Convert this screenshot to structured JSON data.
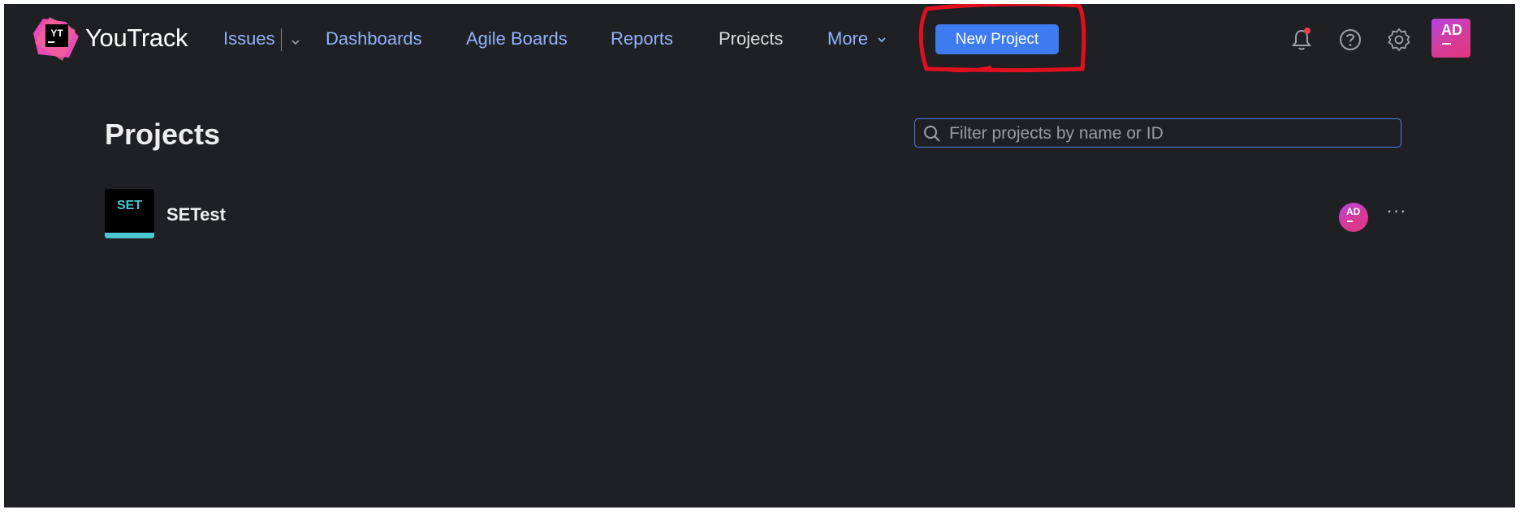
{
  "app": {
    "brand_name": "YouTrack",
    "logo_text": "YT",
    "logo_icon": "youtrack-logo-icon"
  },
  "nav": {
    "issues": "Issues",
    "dashboards": "Dashboards",
    "agile_boards": "Agile Boards",
    "reports": "Reports",
    "projects": "Projects",
    "more": "More",
    "active": "Projects"
  },
  "toolbar": {
    "new_project_label": "New Project"
  },
  "header_icons": [
    "bell-icon",
    "help-icon",
    "gear-icon"
  ],
  "user": {
    "initials": "AD"
  },
  "page": {
    "title": "Projects"
  },
  "search": {
    "placeholder": "Filter projects by name or ID",
    "value": ""
  },
  "projects": [
    {
      "abbr": "SET",
      "name": "SETest",
      "leader_initials": "AD",
      "actions_label": "···"
    }
  ],
  "colors": {
    "background": "#1f2023",
    "link": "#8fb3ff",
    "primary_button": "#3e7bf0",
    "annotation_red": "#e0101d",
    "project_accent": "#49c6d0",
    "notification_dot": "#e8414b"
  }
}
